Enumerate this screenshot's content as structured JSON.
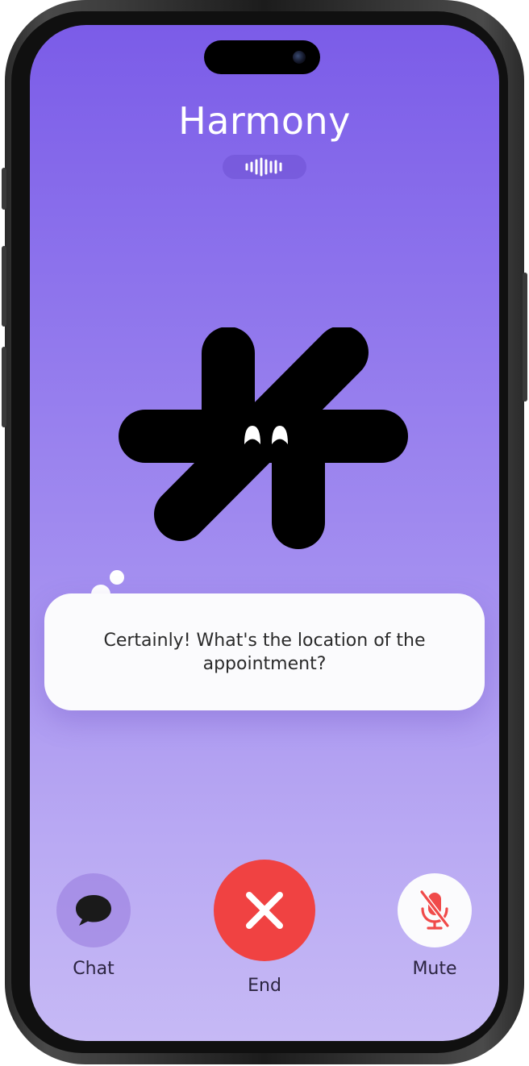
{
  "call": {
    "caller_name": "Harmony",
    "status_indicator": "voice-waveform-icon"
  },
  "assistant": {
    "avatar": "hash-mascot-icon",
    "message": "Certainly! What's the location of the appointment?"
  },
  "controls": {
    "chat": {
      "label": "Chat",
      "icon": "chat-bubble-icon"
    },
    "end": {
      "label": "End",
      "icon": "close-icon",
      "color": "#f04242"
    },
    "mute": {
      "label": "Mute",
      "icon": "microphone-muted-icon",
      "color": "#f04a4a"
    }
  },
  "theme": {
    "gradient_top": "#7b5ce8",
    "gradient_bottom": "#c6b9f5"
  }
}
